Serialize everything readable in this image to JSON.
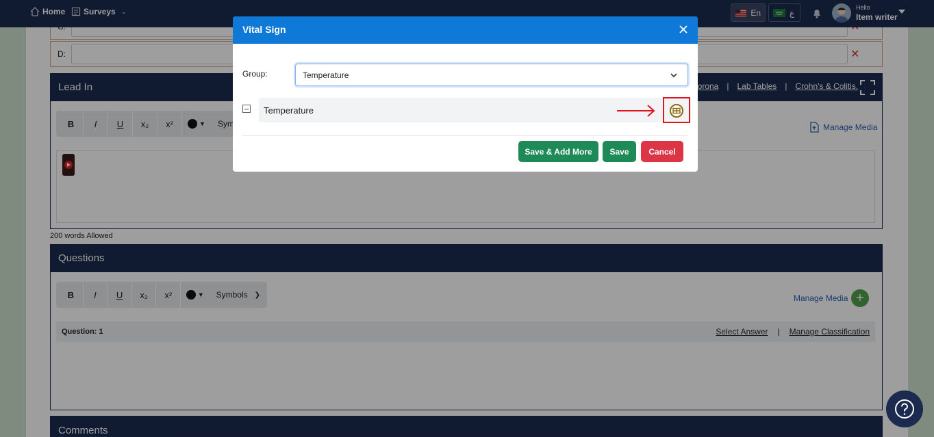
{
  "navbar": {
    "home": "Home",
    "surveys": "Surveys",
    "lang_en": "En",
    "lang_ar": "ع",
    "hello": "Hello",
    "user": "Item writer"
  },
  "options": [
    {
      "label": "C:"
    },
    {
      "label": "D:"
    }
  ],
  "lead_in": {
    "title": "Lead In",
    "links": [
      "Corona",
      "Lab Tables",
      "Crohn's & Colitis."
    ],
    "separators": [
      "|",
      "|"
    ],
    "manage_media": "Manage Media",
    "words_allowed": "200 words Allowed"
  },
  "toolbar": {
    "bold": "B",
    "italic": "I",
    "underline": "U",
    "subscript": "x₂",
    "superscript": "x²",
    "symbols_short": "Symb",
    "symbols": "Symbols"
  },
  "questions": {
    "title": "Questions",
    "manage_media": "Manage Media",
    "question_label": "Question: 1",
    "select_answer": "Select Answer",
    "separator": "|",
    "manage_classification": "Manage Classification"
  },
  "comments": {
    "title": "Comments"
  },
  "modal": {
    "title": "Vital Sign",
    "group_label": "Group:",
    "group_value": "Temperature",
    "tree_item": "Temperature",
    "save_add_more": "Save & Add More",
    "save": "Save",
    "cancel": "Cancel"
  },
  "colors": {
    "navbar": "#1b2a4e",
    "modal_header": "#0f79d8",
    "save_green": "#1e8a57",
    "cancel_red": "#dc3545",
    "highlight": "#e0141c"
  }
}
